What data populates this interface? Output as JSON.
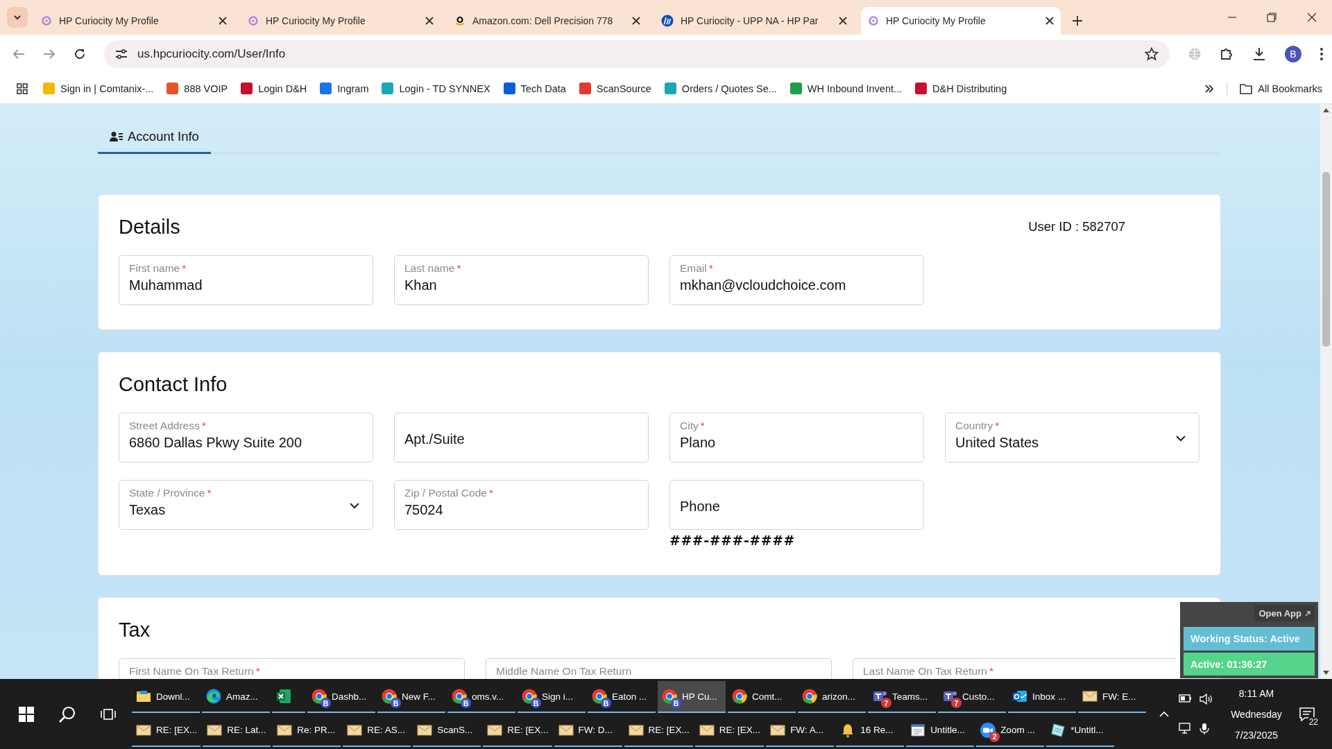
{
  "browser": {
    "tabs": [
      {
        "title": "HP Curiocity My Profile",
        "kind": "curiocity",
        "selected": false
      },
      {
        "title": "HP Curiocity My Profile",
        "kind": "curiocity",
        "selected": false
      },
      {
        "title": "Amazon.com: Dell Precision 778",
        "kind": "amazon",
        "selected": false
      },
      {
        "title": "HP Curiocity - UPP NA - HP Par",
        "kind": "hp",
        "selected": false
      },
      {
        "title": "HP Curiocity My Profile",
        "kind": "curiocity",
        "selected": true
      }
    ],
    "url": "us.hpcuriocity.com/User/Info",
    "profile_initial": "B",
    "bookmarks": [
      {
        "label": "Sign in | Comtanix-...",
        "color": "#f5b800"
      },
      {
        "label": "888 VOIP",
        "color": "#e8542a"
      },
      {
        "label": "Login D&H",
        "color": "#c8102e"
      },
      {
        "label": "Ingram",
        "color": "#1a73e8"
      },
      {
        "label": "Login - TD SYNNEX",
        "color": "#1ba6b8"
      },
      {
        "label": "Tech Data",
        "color": "#0b5ed7"
      },
      {
        "label": "ScanSource",
        "color": "#e03a2f"
      },
      {
        "label": "Orders / Quotes Se...",
        "color": "#1ba6b8"
      },
      {
        "label": "WH Inbound Invent...",
        "color": "#1e9e48"
      },
      {
        "label": "D&H Distributing",
        "color": "#c8102e"
      }
    ],
    "all_bookmarks": "All Bookmarks"
  },
  "page": {
    "tabs": [
      {
        "label": "Account Info",
        "selected": true
      }
    ],
    "details": {
      "title": "Details",
      "user_id": "User ID : 582707",
      "fields": [
        {
          "label": "First name",
          "required_mark": "*",
          "value": "Muhammad",
          "kind": "text"
        },
        {
          "label": "Last name",
          "required_mark": "*",
          "value": "Khan",
          "kind": "text"
        },
        {
          "label": "Email",
          "required_mark": "*",
          "value": "mkhan@vcloudchoice.com",
          "kind": "text"
        }
      ]
    },
    "contact": {
      "title": "Contact Info",
      "fields": [
        {
          "label": "Street Address",
          "required_mark": "*",
          "value": "6860 Dallas Pkwy Suite 200",
          "kind": "text"
        },
        {
          "placeholder": "Apt./Suite",
          "kind": "text"
        },
        {
          "label": "City",
          "required_mark": "*",
          "value": "Plano",
          "kind": "text"
        },
        {
          "label": "Country",
          "required_mark": "*",
          "value": "United States",
          "kind": "select"
        },
        {
          "label": "State / Province",
          "required_mark": "*",
          "value": "Texas",
          "kind": "select"
        },
        {
          "label": "Zip / Postal Code",
          "required_mark": "*",
          "value": "75024",
          "kind": "text"
        },
        {
          "placeholder": "Phone",
          "kind": "text",
          "hint": "###-###-####"
        }
      ]
    },
    "tax": {
      "title": "Tax",
      "fields": [
        {
          "label": "First Name On Tax Return",
          "required_mark": "*",
          "kind": "text"
        },
        {
          "label": "Middle Name On Tax Return",
          "kind": "text"
        },
        {
          "label": "Last Name On Tax Return",
          "required_mark": "*",
          "kind": "text"
        }
      ]
    }
  },
  "widget": {
    "open_app": "Open App",
    "working_status": "Working Status: Active",
    "timer": "Active: 01:36:27"
  },
  "taskbar": {
    "windows": [
      {
        "label": "Downl...",
        "kind": "folder",
        "selected": false
      },
      {
        "label": "Amaz...",
        "kind": "edge",
        "selected": false
      },
      {
        "kind": "excel",
        "selected": false
      },
      {
        "label": "Dashb...",
        "kind": "chrome",
        "badge": "B",
        "selected": false
      },
      {
        "label": "New F...",
        "kind": "chrome",
        "badge": "B",
        "selected": false
      },
      {
        "label": "oms.v...",
        "kind": "chrome",
        "badge": "B",
        "selected": false
      },
      {
        "label": "Sign i...",
        "kind": "chrome",
        "badge": "B",
        "selected": false
      },
      {
        "label": "Eaton ...",
        "kind": "chrome",
        "badge": "B",
        "selected": false
      },
      {
        "label": "HP Cu...",
        "kind": "chrome",
        "badge": "B",
        "selected": true
      },
      {
        "label": "Comt...",
        "kind": "chrome",
        "selected": false
      },
      {
        "label": "arizon...",
        "kind": "chrome",
        "selected": false
      },
      {
        "label": "Teams...",
        "kind": "teams",
        "badge": "7",
        "selected": false
      },
      {
        "label": "Custo...",
        "kind": "teams",
        "badge": "7",
        "selected": false
      },
      {
        "label": "Inbox ...",
        "kind": "outlook",
        "selected": false
      },
      {
        "label": "FW: E...",
        "kind": "mail",
        "selected": false
      },
      {
        "label": "RE: [EX...",
        "kind": "mail",
        "selected": false
      },
      {
        "label": "RE: Lat...",
        "kind": "mail",
        "selected": false
      },
      {
        "label": "Re: PR...",
        "kind": "mail",
        "selected": false
      },
      {
        "label": "RE: AS...",
        "kind": "mail",
        "selected": false
      },
      {
        "label": "ScanS...",
        "kind": "mail",
        "selected": false
      },
      {
        "label": "RE: [EX...",
        "kind": "mail",
        "selected": false
      },
      {
        "label": "FW: D...",
        "kind": "mail",
        "selected": false
      },
      {
        "label": "RE: [EX...",
        "kind": "mail",
        "selected": false
      },
      {
        "label": "RE: [EX...",
        "kind": "mail",
        "selected": false
      },
      {
        "label": "FW: A...",
        "kind": "mail",
        "selected": false
      },
      {
        "label": "16 Re...",
        "kind": "bell",
        "selected": false
      },
      {
        "label": "Untitle...",
        "kind": "notepad",
        "selected": false
      },
      {
        "label": "Zoom ...",
        "kind": "zoom",
        "badge": "2",
        "selected": false
      },
      {
        "label": "*Untitl...",
        "kind": "paint",
        "selected": false
      }
    ],
    "time": "8:11 AM",
    "day": "Wednesday",
    "date": "7/23/2025",
    "notifications": "22"
  }
}
